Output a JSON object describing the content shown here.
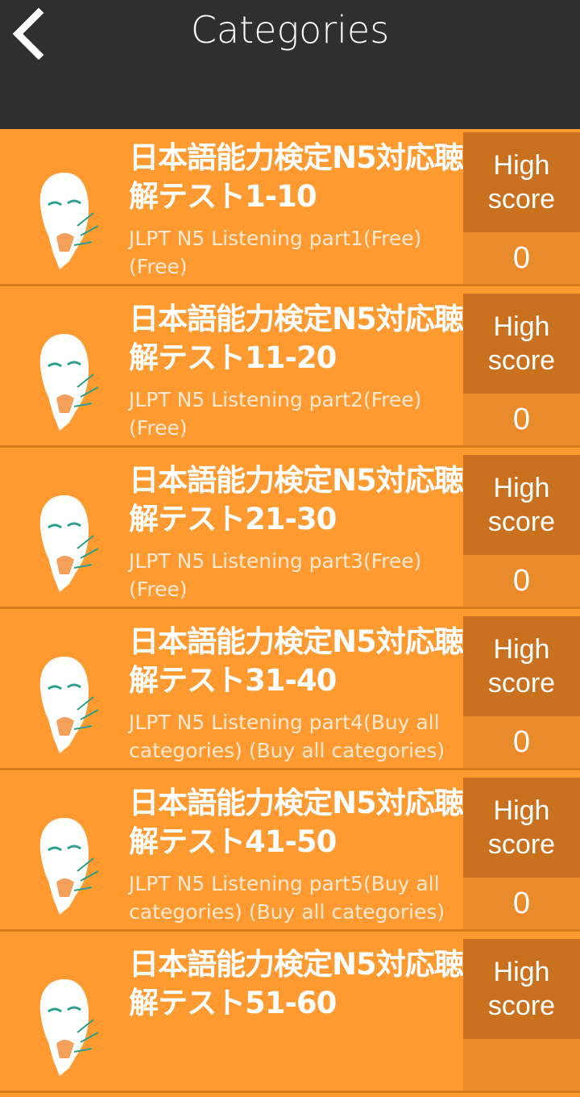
{
  "header": {
    "title": "Categories"
  },
  "score_label": "High score",
  "categories": [
    {
      "title": "日本語能力検定N5対応聴解テスト1-10",
      "subtitle": "JLPT N5 Listening part1(Free) (Free)",
      "high_score_label": "High score",
      "high_score": "0"
    },
    {
      "title": "日本語能力検定N5対応聴解テスト11-20",
      "subtitle": "JLPT N5 Listening part2(Free) (Free)",
      "high_score_label": "High score",
      "high_score": "0"
    },
    {
      "title": "日本語能力検定N5対応聴解テスト21-30",
      "subtitle": "JLPT N5 Listening part3(Free) (Free)",
      "high_score_label": "High score",
      "high_score": "0"
    },
    {
      "title": "日本語能力検定N5対応聴解テスト31-40",
      "subtitle": "JLPT N5 Listening part4(Buy all categories) (Buy all categories)",
      "high_score_label": "High score",
      "high_score": "0"
    },
    {
      "title": "日本語能力検定N5対応聴解テスト41-50",
      "subtitle": "JLPT N5 Listening part5(Buy all categories) (Buy all categories)",
      "high_score_label": "High score",
      "high_score": "0"
    },
    {
      "title": "日本語能力検定N5対応聴解テスト51-60",
      "subtitle": "",
      "high_score_label": "High score",
      "high_score": ""
    }
  ],
  "colors": {
    "background": "#FF9A30",
    "header": "#2f2f2f",
    "score_header": "#C9711F",
    "score_value": "#E98B2B",
    "text": "#ffffff"
  },
  "icons": {
    "back": "chevron-left-icon",
    "avatar": "portrait-illustration"
  }
}
